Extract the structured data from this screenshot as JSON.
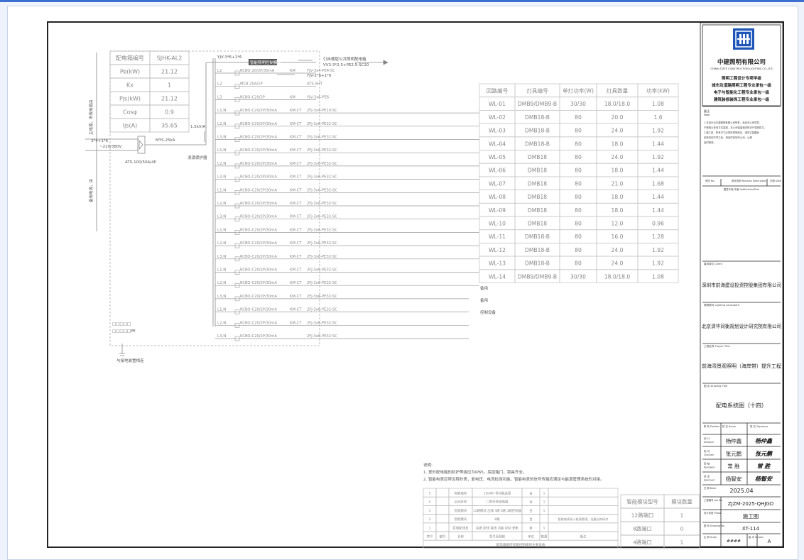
{
  "panel": {
    "rows": [
      {
        "label": "配电箱编号",
        "value": "SJHK-AL2"
      },
      {
        "label": "Pe(kW)",
        "value": "21.12"
      },
      {
        "label": "Kx",
        "value": "1"
      },
      {
        "label": "Pjs(kW)",
        "value": "21.12"
      },
      {
        "label": "Cosφ",
        "value": "0.9"
      },
      {
        "label": "Ijs(A)",
        "value": "35.65"
      }
    ],
    "supply_main": "主电源，市政电缆由",
    "supply_backup": "备用电源，由",
    "cable_left": "3*4+1*6",
    "cable_left2": "~220/380V",
    "ats_label": "ATS-100/50A/4P",
    "surge_label": "MYS-25kA",
    "spd_label": "浪涌保护器",
    "current_label": "1.5kV/A",
    "ground_label": "与接地装置相连",
    "top_cable": "YJV-3*6+1*6",
    "top_cable2": "YJV-2*6+1*6",
    "top_cable3": "YJV-3*6+1*6",
    "smart_module": "智能照明控制模块",
    "remote_note": "引自楼层公共照明配电箱",
    "remote_note2": "VV3-3*2.5+PE2.5-SC20",
    "spare1": "备用",
    "spare2": "备用",
    "ctrl": "控制设备",
    "leg1": "□□□□□",
    "leg2": "□□□□□PE"
  },
  "branches": [
    {
      "phase": "L1",
      "breaker": "RCBO-20/2P/30mA",
      "module": "KM",
      "cable": "YJV-3x4-PE4-SC"
    },
    {
      "phase": "L2",
      "breaker": "MCB 20A/1P",
      "module": "",
      "cable": "ATS-SHT"
    },
    {
      "phase": "L3",
      "breaker": "RCBO-C20/2P",
      "module": "KM",
      "cable": "YJV-3x6-PE6"
    },
    {
      "phase": "L1,N",
      "breaker": "RCBO-C20/2P/30mA",
      "module": "KM-CT",
      "cable": "2FJ-3x4-PE10-SC"
    },
    {
      "phase": "L2,N",
      "breaker": "RCBO-C20/2P/30mA",
      "module": "KM-CT",
      "cable": "2FJ-3x6-PE32-SC"
    },
    {
      "phase": "L3,N",
      "breaker": "RCBO-C20/2P/30mA",
      "module": "KM-CT",
      "cable": "2FJ-3x6-PE32-SC"
    },
    {
      "phase": "L1,N",
      "breaker": "RCBO-C20/2P/30mA",
      "module": "KM-CT",
      "cable": "2FJ-3x6-PE32-SC"
    },
    {
      "phase": "L2,N",
      "breaker": "RCBO-C20/2P/30mA",
      "module": "KM-CT",
      "cable": "2FJ-3x6-PE32-SC"
    },
    {
      "phase": "L3,N",
      "breaker": "RCBO-C20/2P/30mA",
      "module": "KM-CT",
      "cable": "2FJ-3x6-PE32-SC"
    },
    {
      "phase": "L1,N",
      "breaker": "RCBO-C20/2P/30mA",
      "module": "KM-CT",
      "cable": "2FJ-3x6-PE32-SC"
    },
    {
      "phase": "L2,N",
      "breaker": "RCBO-C20/2P/30mA",
      "module": "KM-CT",
      "cable": "2FJ-3x6-PE32-SC"
    },
    {
      "phase": "L3,N",
      "breaker": "RCBO-C20/2P/30mA",
      "module": "KM-CT",
      "cable": "2FJ-3x6-PE32-SC"
    },
    {
      "phase": "L1,N",
      "breaker": "RCBO-C20/2P/30mA",
      "module": "KM-CT",
      "cable": "2FJ-3x6-PE32-SC"
    },
    {
      "phase": "L2,N",
      "breaker": "RCBO-C20/2P/30mA",
      "module": "KM-CT",
      "cable": "2FJ-3x6-PE32-SC"
    },
    {
      "phase": "L3,N",
      "breaker": "RCBO-C20/2P/30mA",
      "module": "KM-CT",
      "cable": "2FJ-3x6-PE32-SC"
    },
    {
      "phase": "L1,N",
      "breaker": "RCBO-C20/2P/30mA",
      "module": "KM-CT",
      "cable": "2FJ-3x6-PE32-SC"
    },
    {
      "phase": "L2,N",
      "breaker": "RCBO-C20/2P/30mA",
      "module": "KM-CT",
      "cable": "2FJ-3x6-PE32-SC"
    },
    {
      "phase": "L3,N",
      "breaker": "RCBO-C20/2P/30mA",
      "module": "KM-CT",
      "cable": "2FJ-3x6-PE32-SC"
    },
    {
      "phase": "L1,N",
      "breaker": "RCBO-C20/2P/30mA",
      "module": "KM-CT",
      "cable": "2FJ-3x6-PE32-SC"
    },
    {
      "phase": "L2,N",
      "breaker": "RCBO-C20/2P/30mA",
      "module": "KM-CT",
      "cable": "2FJ-3x6-PE32-SC"
    },
    {
      "phase": "L3,N",
      "breaker": "RCBO-C20/2P/30mA",
      "module": "",
      "cable": "2FJ-3x6-PE32-SC"
    }
  ],
  "load_table": {
    "headers": [
      "回路编号",
      "灯具编号",
      "单灯功率(W)",
      "灯具数量",
      "功率(kW)"
    ],
    "rows": [
      [
        "WL-01",
        "DMB9/DMB9-B",
        "30/30",
        "18.0/18.0",
        "1.08"
      ],
      [
        "WL-02",
        "DMB18-B",
        "80",
        "20.0",
        "1.6"
      ],
      [
        "WL-03",
        "DMB18-B",
        "80",
        "24.0",
        "1.92"
      ],
      [
        "WL-04",
        "DMB18-B",
        "80",
        "18.0",
        "1.44"
      ],
      [
        "WL-05",
        "DMB18",
        "80",
        "24.0",
        "1.92"
      ],
      [
        "WL-06",
        "DMB18",
        "80",
        "18.0",
        "1.44"
      ],
      [
        "WL-07",
        "DMB18",
        "80",
        "21.0",
        "1.68"
      ],
      [
        "WL-08",
        "DMB18",
        "80",
        "18.0",
        "1.44"
      ],
      [
        "WL-09",
        "DMB18",
        "80",
        "18.0",
        "1.44"
      ],
      [
        "WL-10",
        "DMB18",
        "80",
        "12.0",
        "0.96"
      ],
      [
        "WL-11",
        "DMB18-B",
        "80",
        "16.0",
        "1.28"
      ],
      [
        "WL-12",
        "DMB18-B",
        "80",
        "24.0",
        "1.92"
      ],
      [
        "WL-13",
        "DMB18-B",
        "80",
        "24.0",
        "1.92"
      ],
      [
        "WL-14",
        "DMB9/DMB9-B",
        "30/30",
        "18.0/18.0",
        "1.08"
      ]
    ]
  },
  "notes": {
    "title": "说明:",
    "lines": [
      "1. 室外配电箱的防护等级应为IP65，底层箱门，锁具齐全。",
      "2. 智能电表应带远程抄表，复电压、电流检测功能，智能电表的信号传输应满足与能源管理系统的对接。"
    ]
  },
  "equip_table": {
    "rows": [
      [
        "5",
        "",
        "智能电表",
        "12kWh 带功能连接",
        "台",
        "1",
        ""
      ],
      [
        "4",
        "",
        "启动开关",
        "门禁开关继电器",
        "台",
        "1",
        ""
      ],
      [
        "3",
        "",
        "智能模块",
        "12路模块 出线 4路 8路 3路控制器",
        "台",
        "1",
        ""
      ],
      [
        "2",
        "",
        "智能模块",
        "8路",
        "台",
        "",
        ""
      ],
      [
        "1",
        "",
        "区域配线盒",
        "底座 配线 接线 功能 控制 采集",
        "套",
        "1",
        ""
      ]
    ],
    "footer": [
      "序号",
      "编号",
      "名称",
      "型号及规格",
      "单位",
      "数量",
      "备注"
    ],
    "caption": "配电箱箱内智能控制模块主要设备",
    "remark": "智能电表接入能源管理，设备自带网口"
  },
  "module_table": {
    "headers": [
      "智能模块型号",
      "模块数量"
    ],
    "rows": [
      [
        "12路端口",
        "1"
      ],
      [
        "8路端口",
        "0"
      ],
      [
        "4路端口",
        "1"
      ]
    ]
  },
  "title_block": {
    "company": "中建照明有限公司",
    "company_en": "CHINA STATE CONSTRUCTION LIGHTING CO.,LTD",
    "quals": [
      "照明工程设计专项甲级",
      "城市及道路照明工程专业承包一级",
      "电子与智能化工程专业承包一级",
      "建筑装修装饰工程专业承包一级"
    ],
    "notes_title": "备注",
    "notes_en": "Note",
    "note_lines": [
      "1.本设计为中建照明有限公司所有，未经本公司同意，",
      "不得用以任何方式复制，本公司保留相关知识产权的权力。",
      "2.施工前：所有尺寸必须在现场核实，请勿丈量图纸",
      "如有任何不符之处，请及时告知本公司，以便",
      "及时修改。"
    ],
    "rev_no": "修改\nNo.",
    "rev_desc": "修改说明\nRevision Description",
    "rev_date": "日期\nDate",
    "cert": "图签专用/平面\nNotification/Plan",
    "client_label": "建设单位\nClient",
    "client": "深圳市前海建设投资控股集团有限公司",
    "consultant_label": "照明顾问\nLighting consultant",
    "consultant": "北京清华同衡规划设计研究院有限公司",
    "project_label": "工程名称\nProject Title",
    "project": "前海湾景观照明（海岸带）提升工程",
    "drawing_label": "图 名\nDrawing Title",
    "drawing": "配电系统图（十四）",
    "pos_label": "职 务\nPosition",
    "name_label": "姓 名\nName",
    "sign_label": "签 名\nSignature",
    "staff": [
      {
        "role": "设 计\nDesigner",
        "name": "杨仲鑫",
        "sign": "杨仲鑫"
      },
      {
        "role": "校 对\nChecked",
        "name": "张元鹏",
        "sign": "张元鹏"
      },
      {
        "role": "审 核\nReviewed",
        "name": "常 胜",
        "sign": "常 胜"
      },
      {
        "role": "审 定\nApproved",
        "name": "杨智安",
        "sign": "杨智安"
      }
    ],
    "date_label": "日 期\nDate",
    "date": "2025.04",
    "job_label": "工程编号\nJob No.",
    "job": "ZJZM-2025-QHJGD",
    "phase_label": "设计阶段\nPhase",
    "phase": "施工图",
    "dwgno_label": "图 号\nDrawing No.",
    "dwgno": "XT-114",
    "scale_label": "比 例\nScale",
    "scale": "####",
    "version_label": "版 本\nVersion",
    "version": "A"
  }
}
